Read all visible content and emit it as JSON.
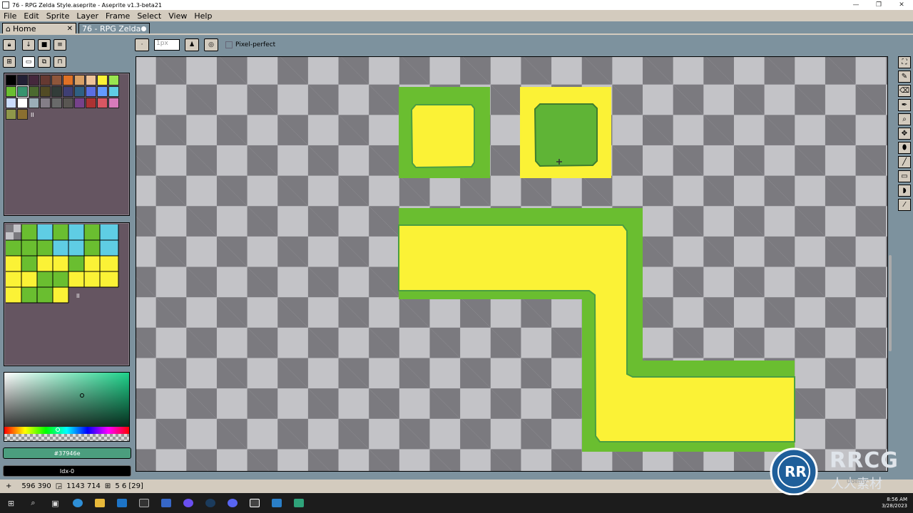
{
  "window": {
    "title": "76 - RPG Zelda Style.aseprite - Aseprite v1.3-beta21",
    "controls": [
      "—",
      "❐",
      "✕"
    ]
  },
  "menu": [
    "File",
    "Edit",
    "Sprite",
    "Layer",
    "Frame",
    "Select",
    "View",
    "Help"
  ],
  "tabs": {
    "home": {
      "label": "Home",
      "close": "✕"
    },
    "document": {
      "label": "76 - RPG Zelda"
    }
  },
  "context_bar": {
    "brush_size": "1px",
    "pixel_perfect_label": "Pixel-perfect"
  },
  "palette": {
    "colors": [
      "#000000",
      "#222034",
      "#45283c",
      "#663931",
      "#8f563b",
      "#df7126",
      "#d9a066",
      "#eec39a",
      "#fbf236",
      "#99e550",
      "#6abe30",
      "#37946e",
      "#4b692f",
      "#524b24",
      "#323c39",
      "#3f3f74",
      "#306082",
      "#5b6ee1",
      "#639bff",
      "#5fcde4",
      "#cbdbfc",
      "#ffffff",
      "#9badb7",
      "#847e87",
      "#696a6a",
      "#595652",
      "#76428a",
      "#ac3232",
      "#d95763",
      "#d77bba",
      "#8f974a",
      "#8a6f30"
    ],
    "selected_color": "#37946e"
  },
  "color_fields": {
    "hex": "#37946e",
    "index": "Idx-0"
  },
  "status": {
    "cursor_pos": "596 390",
    "sprite_size": "1143 714",
    "grid": "5 6 [29]"
  },
  "taskbar": {
    "time": "8:56 AM",
    "date": "3/28/2023"
  },
  "watermark": {
    "brand": "RRCG",
    "cn": "人人素材",
    "udemy": "Udemy"
  }
}
